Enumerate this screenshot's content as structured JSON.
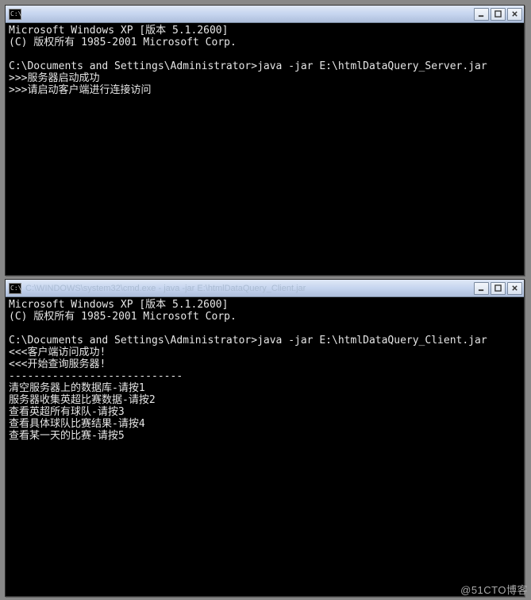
{
  "window1": {
    "icon_label": "C:\\",
    "title": "",
    "minimize_tip": "Minimize",
    "maximize_tip": "Maximize",
    "close_tip": "Close",
    "lines": [
      "Microsoft Windows XP [版本 5.1.2600]",
      "(C) 版权所有 1985-2001 Microsoft Corp.",
      "",
      "C:\\Documents and Settings\\Administrator>java -jar E:\\htmlDataQuery_Server.jar",
      ">>>服务器启动成功",
      ">>>请启动客户端进行连接访问"
    ]
  },
  "window2": {
    "icon_label": "C:\\",
    "title": "C:\\WINDOWS\\system32\\cmd.exe - java -jar E:\\htmlDataQuery_Client.jar",
    "minimize_tip": "Minimize",
    "maximize_tip": "Maximize",
    "close_tip": "Close",
    "lines": [
      "Microsoft Windows XP [版本 5.1.2600]",
      "(C) 版权所有 1985-2001 Microsoft Corp.",
      "",
      "C:\\Documents and Settings\\Administrator>java -jar E:\\htmlDataQuery_Client.jar",
      "<<<客户端访问成功!",
      "<<<开始查询服务器!",
      "----------------------------",
      "清空服务器上的数据库-请按1",
      "服务器收集英超比赛数据-请按2",
      "查看英超所有球队-请按3",
      "查看具体球队比赛结果-请按4",
      "查看某一天的比赛-请按5"
    ]
  },
  "watermark": "@51CTO博客"
}
